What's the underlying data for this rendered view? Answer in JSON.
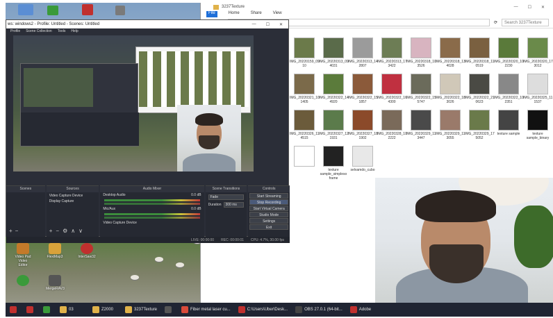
{
  "desktop": {
    "icons": [
      {
        "label": "Video Pad Video Editor",
        "icon": "videopad-icon",
        "color": "#c47a2a"
      },
      {
        "label": "FlexiMap3",
        "icon": "flexi-icon",
        "color": "#d9a23a"
      },
      {
        "label": "InterSaw32",
        "icon": "intersaw-icon",
        "color": "#c0302e"
      },
      {
        "label": "",
        "icon": "recycle-icon",
        "color": "#3a9a3a"
      },
      {
        "label": "MergeRAV3",
        "icon": "merge-icon",
        "color": "#555"
      }
    ],
    "top_icons": [
      {
        "icon": "computer-icon",
        "color": "#5b8ed4"
      },
      {
        "icon": "app-icon",
        "color": "#3a9a3a"
      },
      {
        "icon": "app-icon",
        "color": "#c0302e"
      },
      {
        "icon": "app-icon",
        "color": "#7a7a7a"
      }
    ]
  },
  "taskbar": {
    "items": [
      {
        "label": "",
        "icon": "windows-start-icon",
        "color": "#c0302e"
      },
      {
        "label": "",
        "icon": "app-icon",
        "color": "#c0302e"
      },
      {
        "label": "",
        "icon": "app-icon",
        "color": "#3a9a3a"
      },
      {
        "label": "03",
        "icon": "folder-icon",
        "color": "#e0b24a"
      },
      {
        "label": "Z2000",
        "icon": "folder-icon",
        "color": "#e0b24a"
      },
      {
        "label": "3237Texture",
        "icon": "folder-icon",
        "color": "#e0b24a"
      },
      {
        "label": "",
        "icon": "obs-icon",
        "color": "#555"
      },
      {
        "label": "Fiber metal laser cu...",
        "icon": "chrome-icon",
        "color": "#d94a3a"
      },
      {
        "label": "C:\\Users\\Uber\\Desk...",
        "icon": "file-icon",
        "color": "#c0302e"
      },
      {
        "label": "OBS 27.0.1 (64-bit...",
        "icon": "obs-icon",
        "color": "#444"
      },
      {
        "label": "Adobe",
        "icon": "adobe-icon",
        "color": "#c0302e"
      }
    ]
  },
  "explorer": {
    "title": "3237Texture",
    "ribbon": [
      "File",
      "Home",
      "Share",
      "View"
    ],
    "search_placeholder": "Search 3237Texture",
    "files": [
      {
        "name": "IMG_20220159_09 10",
        "color": "#6b7a4a"
      },
      {
        "name": "IMG_20220313_09 4031",
        "color": "#5a6b4a"
      },
      {
        "name": "IMG_20220313_14 2807",
        "color": "#9b9b9b"
      },
      {
        "name": "IMG_20220313_17 3422",
        "color": "#6d7d55"
      },
      {
        "name": "IMG_20220318_10 3526",
        "color": "#d8b4c0"
      },
      {
        "name": "IMG_20220318_13 4028",
        "color": "#8a6b4a"
      },
      {
        "name": "IMG_20220318_11 0519",
        "color": "#7a6040"
      },
      {
        "name": "IMG_20220320_10 2230",
        "color": "#5a7a3a"
      },
      {
        "name": "IMG_20220320_17 3012",
        "color": "#6a8a4a"
      },
      {
        "name": "IMG_20220321_10 1405",
        "color": "#7b6a4a"
      },
      {
        "name": "IMG_20220322_14 4920",
        "color": "#5b7b3b"
      },
      {
        "name": "IMG_20220322_15 1857",
        "color": "#8b5a3a"
      },
      {
        "name": "IMG_20220322_16 4300",
        "color": "#c03040"
      },
      {
        "name": "IMG_20220322_15 5747",
        "color": "#6b6b5b"
      },
      {
        "name": "IMG_20220322_18 3026",
        "color": "#d0c8b8"
      },
      {
        "name": "IMG_20220322_21 0623",
        "color": "#4a4a44"
      },
      {
        "name": "IMG_20220322_10 2351",
        "color": "#888"
      },
      {
        "name": "IMG_20220325_11 1537",
        "color": "#ddd"
      },
      {
        "name": "IMG_20220326_11 4515",
        "color": "#6b5b3b"
      },
      {
        "name": "IMG_20220327_12 1931",
        "color": "#5b7b4b"
      },
      {
        "name": "IMG_20220327_18 1902",
        "color": "#8b4a2a"
      },
      {
        "name": "IMG_20220328_10 2222",
        "color": "#7a6a5a"
      },
      {
        "name": "IMG_20220329_11 3447",
        "color": "#4a4a4a"
      },
      {
        "name": "IMG_20220329_11 3055",
        "color": "#9a7a6a"
      },
      {
        "name": "IMG_20220329_17 5052",
        "color": "#6a7a4a"
      },
      {
        "name": "texture sample",
        "color": "#444"
      },
      {
        "name": "texture sample_binary",
        "color": "#111"
      },
      {
        "name": "",
        "color": "#fff"
      },
      {
        "name": "texture sample_simpleso frame",
        "color": "#222"
      },
      {
        "name": "selvamdo_cubo",
        "color": "#e8e8e8"
      }
    ]
  },
  "obs": {
    "title": "ws: windows2 - Profile: Untitled - Scenes: Untitled",
    "menu": [
      "Profile",
      "Scene Collection",
      "Tools",
      "Help"
    ],
    "dock_titles": [
      "Scenes",
      "Sources",
      "Audio Mixer",
      "Scene Transitions",
      "Controls"
    ],
    "sources": [
      "Video Capture Device",
      "Display Capture"
    ],
    "mixer": [
      {
        "name": "Desktop Audio",
        "db": "0.0 dB"
      },
      {
        "name": "Mic/Aux",
        "db": "0.0 dB"
      },
      {
        "name": "Video Capture Device",
        "db": ""
      }
    ],
    "transition": {
      "type": "Fade",
      "duration_label": "Duration",
      "duration": "300 ms"
    },
    "controls": [
      "Start Streaming",
      "Stop Recording",
      "Start Virtual Camera",
      "Studio Mode",
      "Settings",
      "Exit"
    ],
    "status": {
      "live": "LIVE: 00:00:00",
      "rec": "REC: 00:00:01",
      "cpu": "CPU: 4.7%, 30.00 fps"
    }
  }
}
